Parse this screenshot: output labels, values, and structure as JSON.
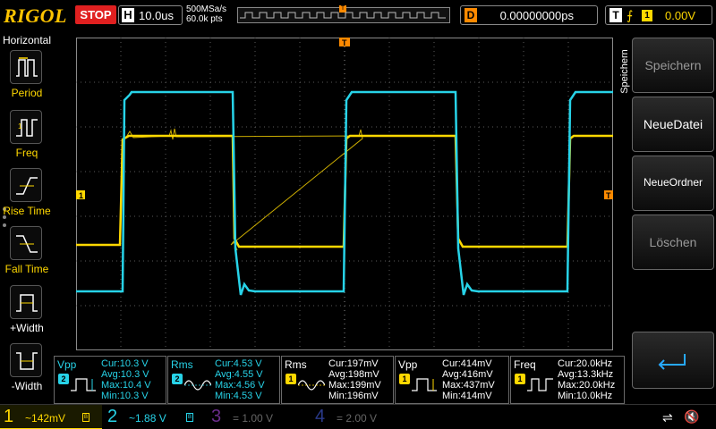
{
  "topbar": {
    "brand": "RIGOL",
    "run_state": "STOP",
    "horizontal_label": "H",
    "timebase": "10.0us",
    "sample_rate": "500MSa/s",
    "memory_depth": "60.0k pts",
    "trigger_marker": "T",
    "delay_label": "D",
    "delay_value": "0.00000000ps",
    "trigger_label": "T",
    "trigger_edge": "⨍",
    "trigger_source": "1",
    "trigger_level": "0.00V"
  },
  "left_panel": {
    "title": "Horizontal",
    "items": [
      {
        "label": "Period"
      },
      {
        "label": "Freq"
      },
      {
        "label": "Rise Time"
      },
      {
        "label": "Fall Time"
      },
      {
        "label": "+Width"
      },
      {
        "label": "-Width"
      }
    ]
  },
  "right_panel": {
    "tab": "Speichern",
    "buttons": [
      {
        "label": "Speichern",
        "enabled": false
      },
      {
        "label": "NeueDatei",
        "enabled": true
      },
      {
        "label": "NeueOrdner",
        "enabled": true
      },
      {
        "label": "Löschen",
        "enabled": false
      }
    ],
    "back_icon": "return-arrow-icon"
  },
  "markers": {
    "ch1_level": "1",
    "trigger_level": "T",
    "trigger_position": "T"
  },
  "measurements": [
    {
      "name": "Vpp",
      "channel": "2",
      "cur": "Cur:10.3 V",
      "avg": "Avg:10.3 V",
      "max": "Max:10.4 V",
      "min": "Min:10.3 V"
    },
    {
      "name": "Rms",
      "channel": "2",
      "cur": "Cur:4.53 V",
      "avg": "Avg:4.55 V",
      "max": "Max:4.56 V",
      "min": "Min:4.53 V"
    },
    {
      "name": "Rms",
      "channel": "1",
      "cur": "Cur:197mV",
      "avg": "Avg:198mV",
      "max": "Max:199mV",
      "min": "Min:196mV"
    },
    {
      "name": "Vpp",
      "channel": "1",
      "cur": "Cur:414mV",
      "avg": "Avg:416mV",
      "max": "Max:437mV",
      "min": "Min:414mV"
    },
    {
      "name": "Freq",
      "channel": "1",
      "cur": "Cur:20.0kHz",
      "avg": "Avg:13.3kHz",
      "max": "Max:20.0kHz",
      "min": "Min:10.0kHz"
    }
  ],
  "channels": [
    {
      "num": "1",
      "coupling": "~",
      "scale": "142mV",
      "color": "#ffd800",
      "active": true
    },
    {
      "num": "2",
      "coupling": "~",
      "scale": "1.88 V",
      "color": "#27d3e8",
      "active": true
    },
    {
      "num": "3",
      "coupling": "=",
      "scale": "1.00 V",
      "color": "#a020f0",
      "active": false
    },
    {
      "num": "4",
      "coupling": "=",
      "scale": "2.00 V",
      "color": "#3050ff",
      "active": false
    }
  ],
  "status_icons": [
    "usb-icon",
    "sound-muted-icon"
  ],
  "colors": {
    "ch1": "#ffd800",
    "ch2": "#27d3e8",
    "brand": "#ffc400",
    "stop": "#e02020",
    "trigger": "#ff8a00"
  }
}
